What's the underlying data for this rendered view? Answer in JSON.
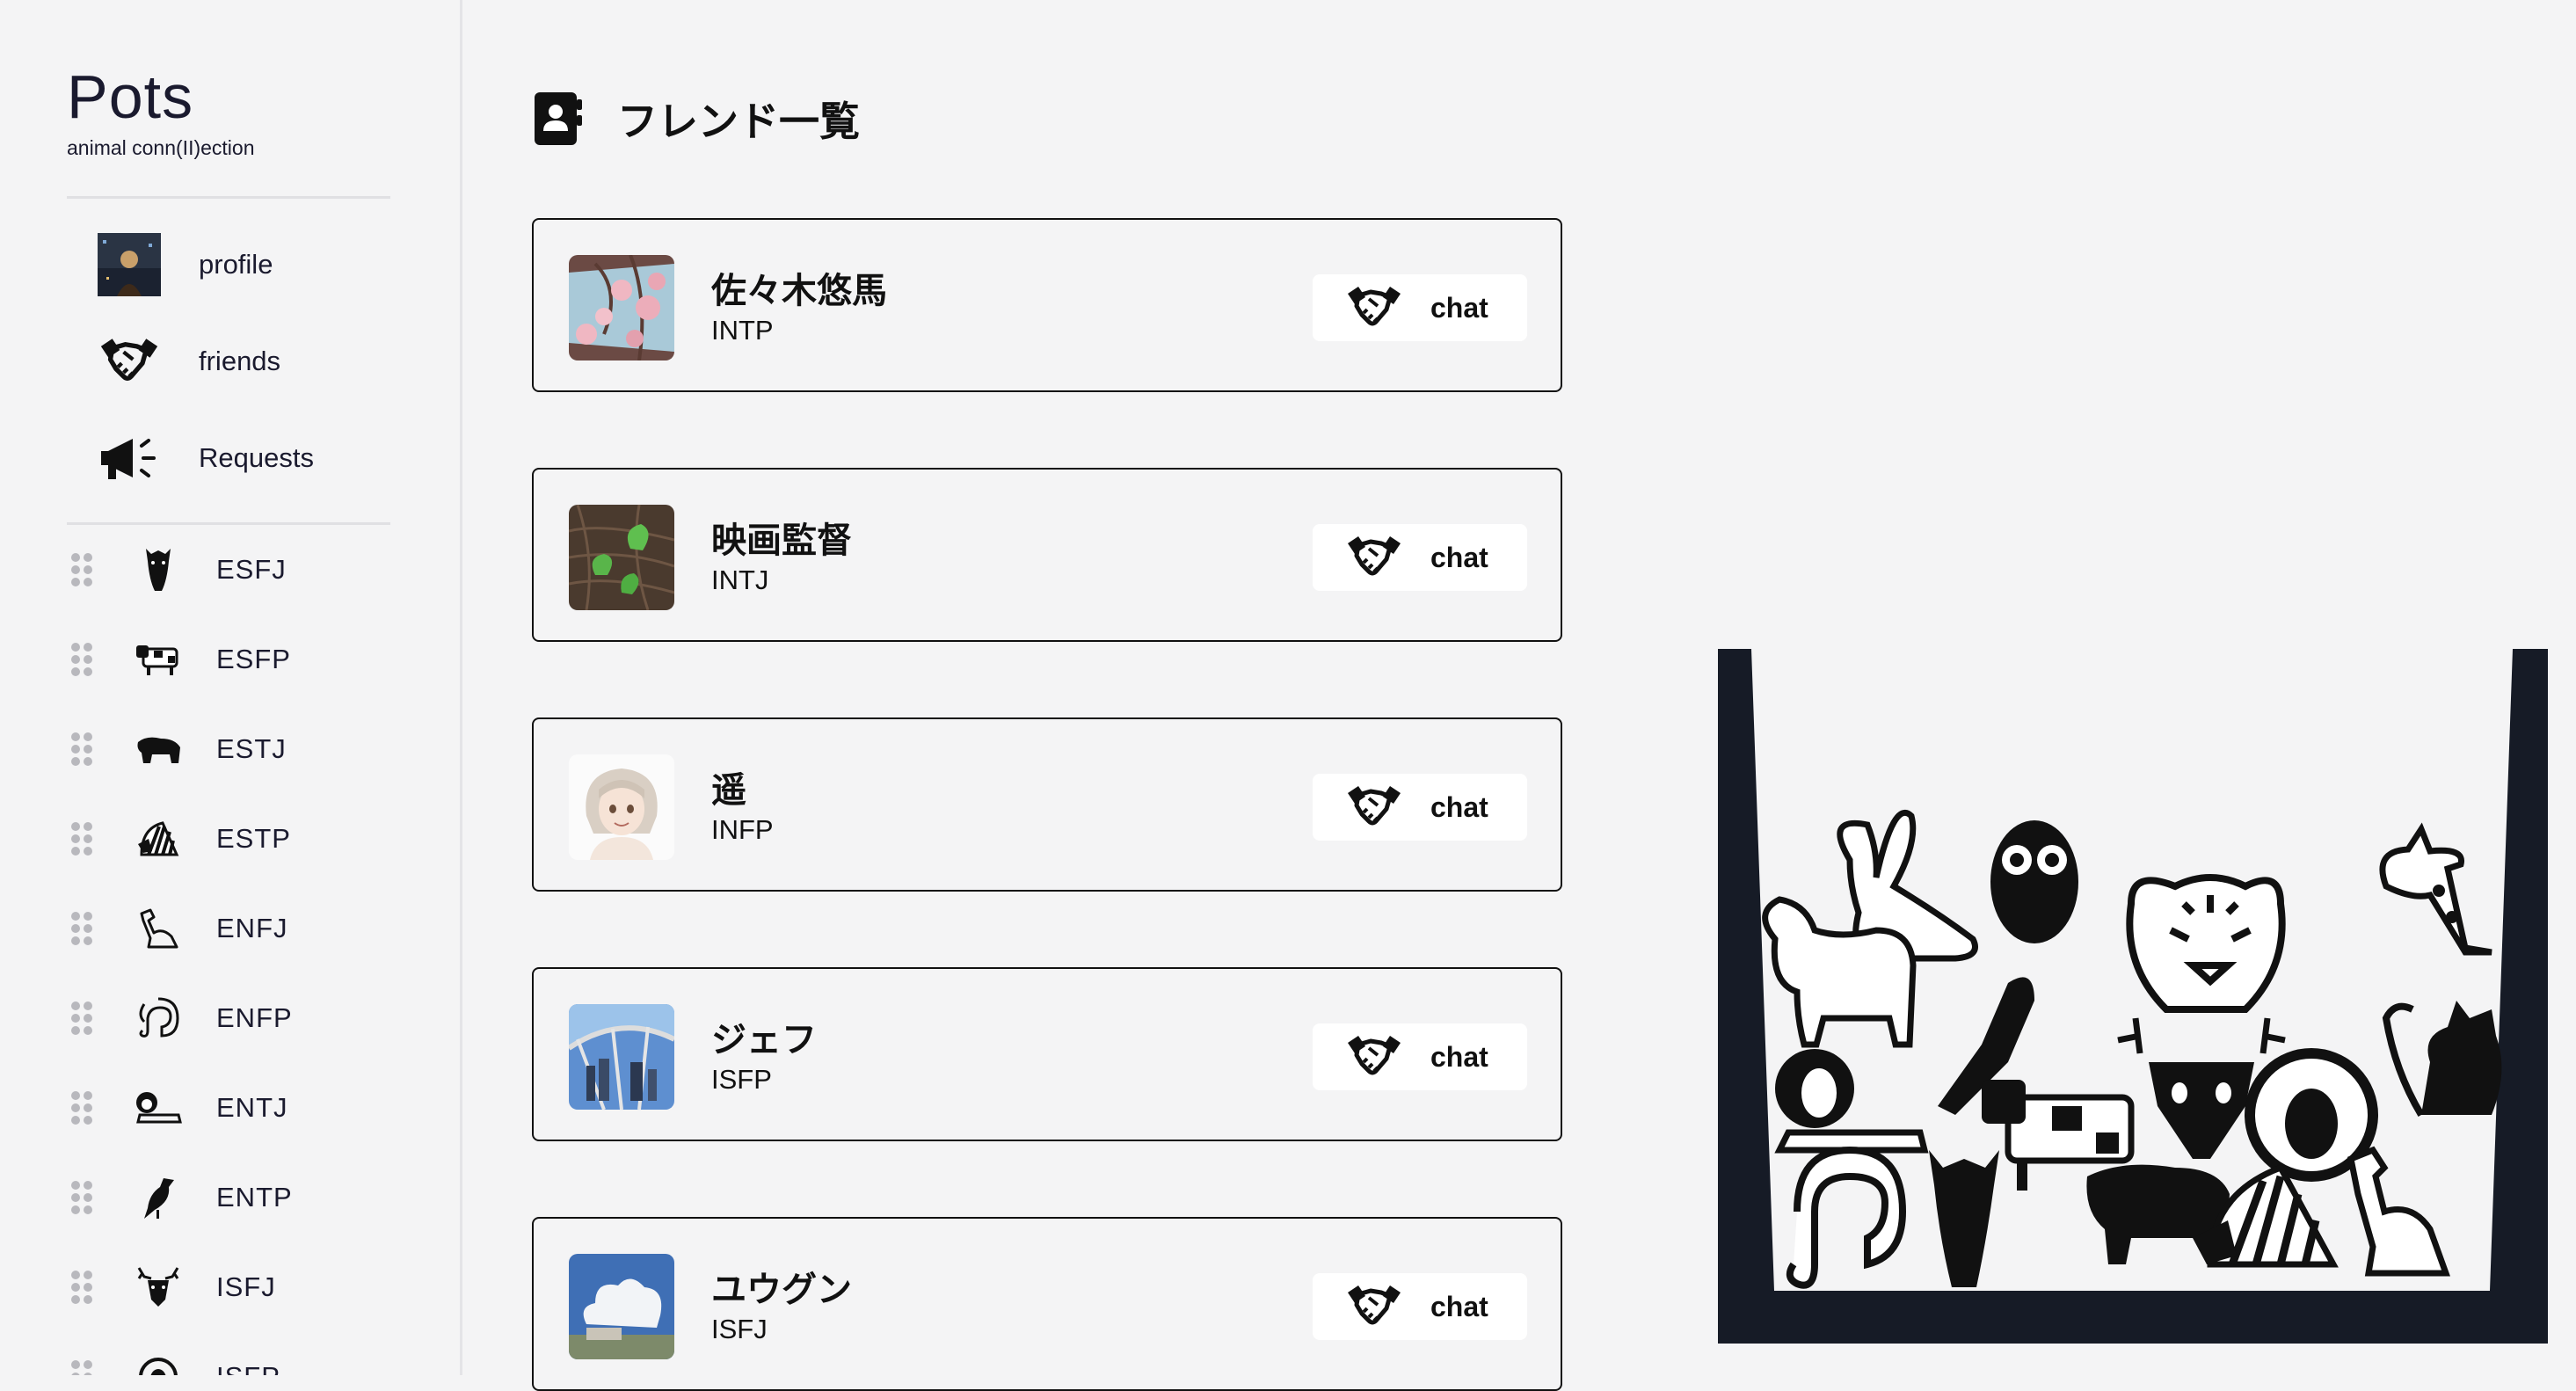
{
  "app": {
    "name": "Pots",
    "tagline": "animal conn(II)ection"
  },
  "nav": [
    {
      "label": "profile"
    },
    {
      "label": "friends"
    },
    {
      "label": "Requests"
    }
  ],
  "mbti_list": [
    {
      "label": "ESFJ",
      "icon": "horse-icon"
    },
    {
      "label": "ESFP",
      "icon": "cow-icon"
    },
    {
      "label": "ESTJ",
      "icon": "bear-icon"
    },
    {
      "label": "ESTP",
      "icon": "zebra-icon"
    },
    {
      "label": "ENFJ",
      "icon": "dog-icon"
    },
    {
      "label": "ENFP",
      "icon": "elephant-icon"
    },
    {
      "label": "ENTJ",
      "icon": "lion-icon"
    },
    {
      "label": "ENTP",
      "icon": "bird-icon"
    },
    {
      "label": "ISFJ",
      "icon": "deer-icon"
    },
    {
      "label": "ISFP",
      "icon": "sheep-icon"
    }
  ],
  "page": {
    "title": "フレンド一覧",
    "icon": "contact-book-icon"
  },
  "friends": [
    {
      "name": "佐々木悠馬",
      "type": "INTP",
      "chat_label": "chat"
    },
    {
      "name": "映画監督",
      "type": "INTJ",
      "chat_label": "chat"
    },
    {
      "name": "遥",
      "type": "INFP",
      "chat_label": "chat"
    },
    {
      "name": "ジェフ",
      "type": "ISFP",
      "chat_label": "chat"
    },
    {
      "name": "ユウグン",
      "type": "ISFJ",
      "chat_label": "chat"
    }
  ],
  "colors": {
    "background": "#f4f4f5",
    "dark": "#161b26",
    "text": "#111111"
  }
}
